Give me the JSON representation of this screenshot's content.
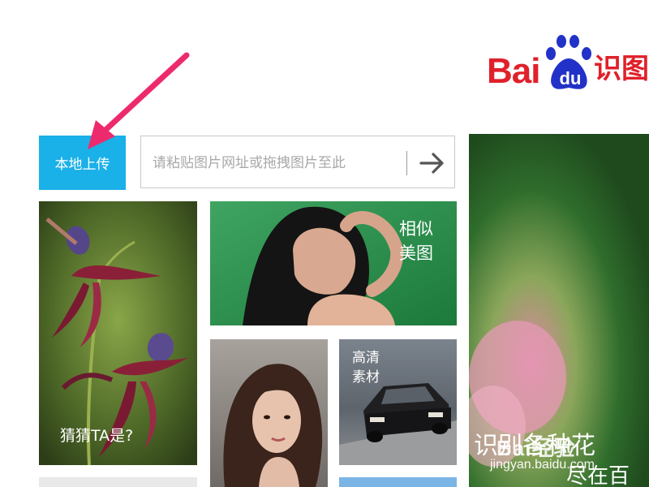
{
  "logo": {
    "brand_text": "Bai",
    "du_text": "du",
    "product_text": "识图"
  },
  "search": {
    "upload_label": "本地上传",
    "placeholder": "请粘贴图片网址或拖拽图片至此",
    "submit_icon": "arrow-right-icon"
  },
  "tiles": {
    "guess_label": "猜猜TA是?",
    "similar_label_line1": "相似",
    "similar_label_line2": "美图",
    "hd_label_line1": "高清",
    "hd_label_line2": "素材"
  },
  "hero": {
    "text_line1": "识别各种花",
    "text_line2": "尽在百"
  },
  "watermark": {
    "brand": "Bai经验",
    "url": "jingyan.baidu.com"
  },
  "colors": {
    "upload_button": "#1ab0e8",
    "logo_red": "#e0202a",
    "logo_blue": "#2232c8",
    "annotation_arrow": "#ee2a6e"
  }
}
